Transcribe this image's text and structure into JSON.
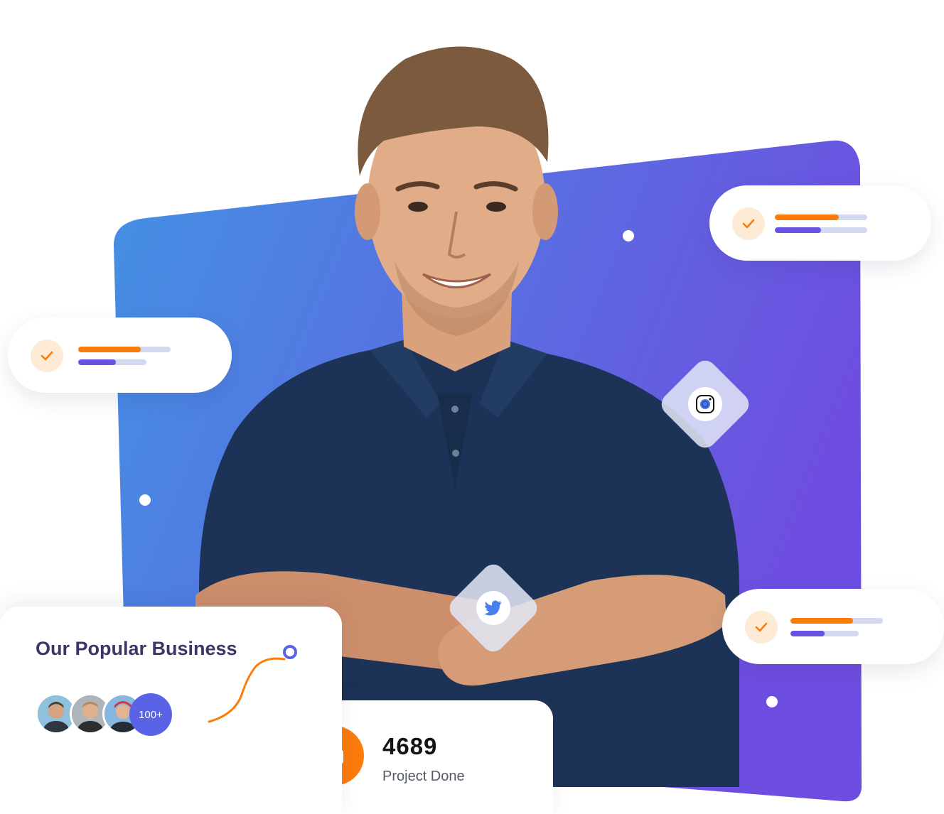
{
  "colors": {
    "gradient_start": "#4391e3",
    "gradient_end": "#6e4ee0",
    "accent_orange": "#fb7b0b",
    "accent_purple": "#6653e2",
    "track": "#d3d9ee",
    "title_text": "#3c3566"
  },
  "status_cards": [
    {
      "icon": "check-icon",
      "progress_orange": 0.69,
      "progress_purple": 0.5
    },
    {
      "icon": "check-icon",
      "progress_orange": 0.68,
      "progress_purple": 0.55
    },
    {
      "icon": "check-icon",
      "progress_orange": 0.68,
      "progress_purple": 0.5
    }
  ],
  "social": {
    "instagram": "instagram-icon",
    "twitter": "twitter-icon"
  },
  "business": {
    "title": "Our Popular Business",
    "avatar_count": "100+"
  },
  "project": {
    "count": "4689",
    "label": "Project Done",
    "icon": "folder-icon"
  }
}
